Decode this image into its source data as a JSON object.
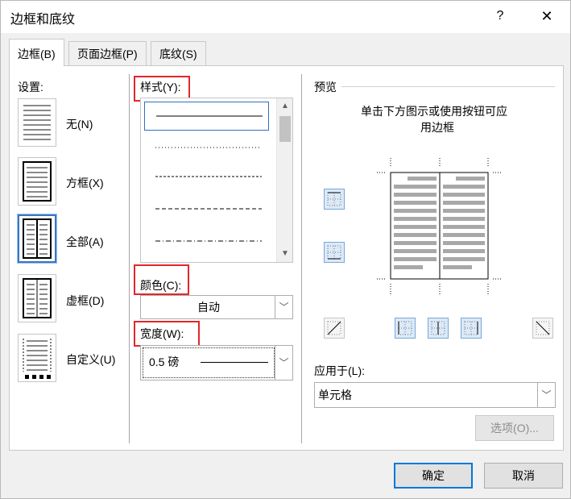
{
  "window": {
    "title": "边框和底纹",
    "help": "?",
    "close": "✕"
  },
  "tabs": [
    {
      "label": "边框(B)",
      "active": true
    },
    {
      "label": "页面边框(P)",
      "active": false
    },
    {
      "label": "底纹(S)",
      "active": false
    }
  ],
  "settings": {
    "heading": "设置:",
    "options": [
      {
        "label": "无(N)",
        "selected": false
      },
      {
        "label": "方框(X)",
        "selected": false
      },
      {
        "label": "全部(A)",
        "selected": true
      },
      {
        "label": "虚框(D)",
        "selected": false
      },
      {
        "label": "自定义(U)",
        "selected": false
      }
    ]
  },
  "style": {
    "heading": "样式(Y):",
    "items": [
      "solid",
      "dotted",
      "dashed-small",
      "dashed",
      "dash-dot"
    ],
    "selected_index": 0
  },
  "color": {
    "heading": "颜色(C):",
    "value": "自动"
  },
  "width": {
    "heading": "宽度(W):",
    "value": "0.5 磅"
  },
  "preview": {
    "heading": "预览",
    "hint_line1": "单击下方图示或使用按钮可应",
    "hint_line2": "用边框"
  },
  "apply_to": {
    "heading": "应用于(L):",
    "value": "单元格"
  },
  "buttons": {
    "options": "选项(O)...",
    "ok": "确定",
    "cancel": "取消"
  },
  "colors": {
    "highlight": "#e3262b",
    "accent": "#0078d7"
  }
}
